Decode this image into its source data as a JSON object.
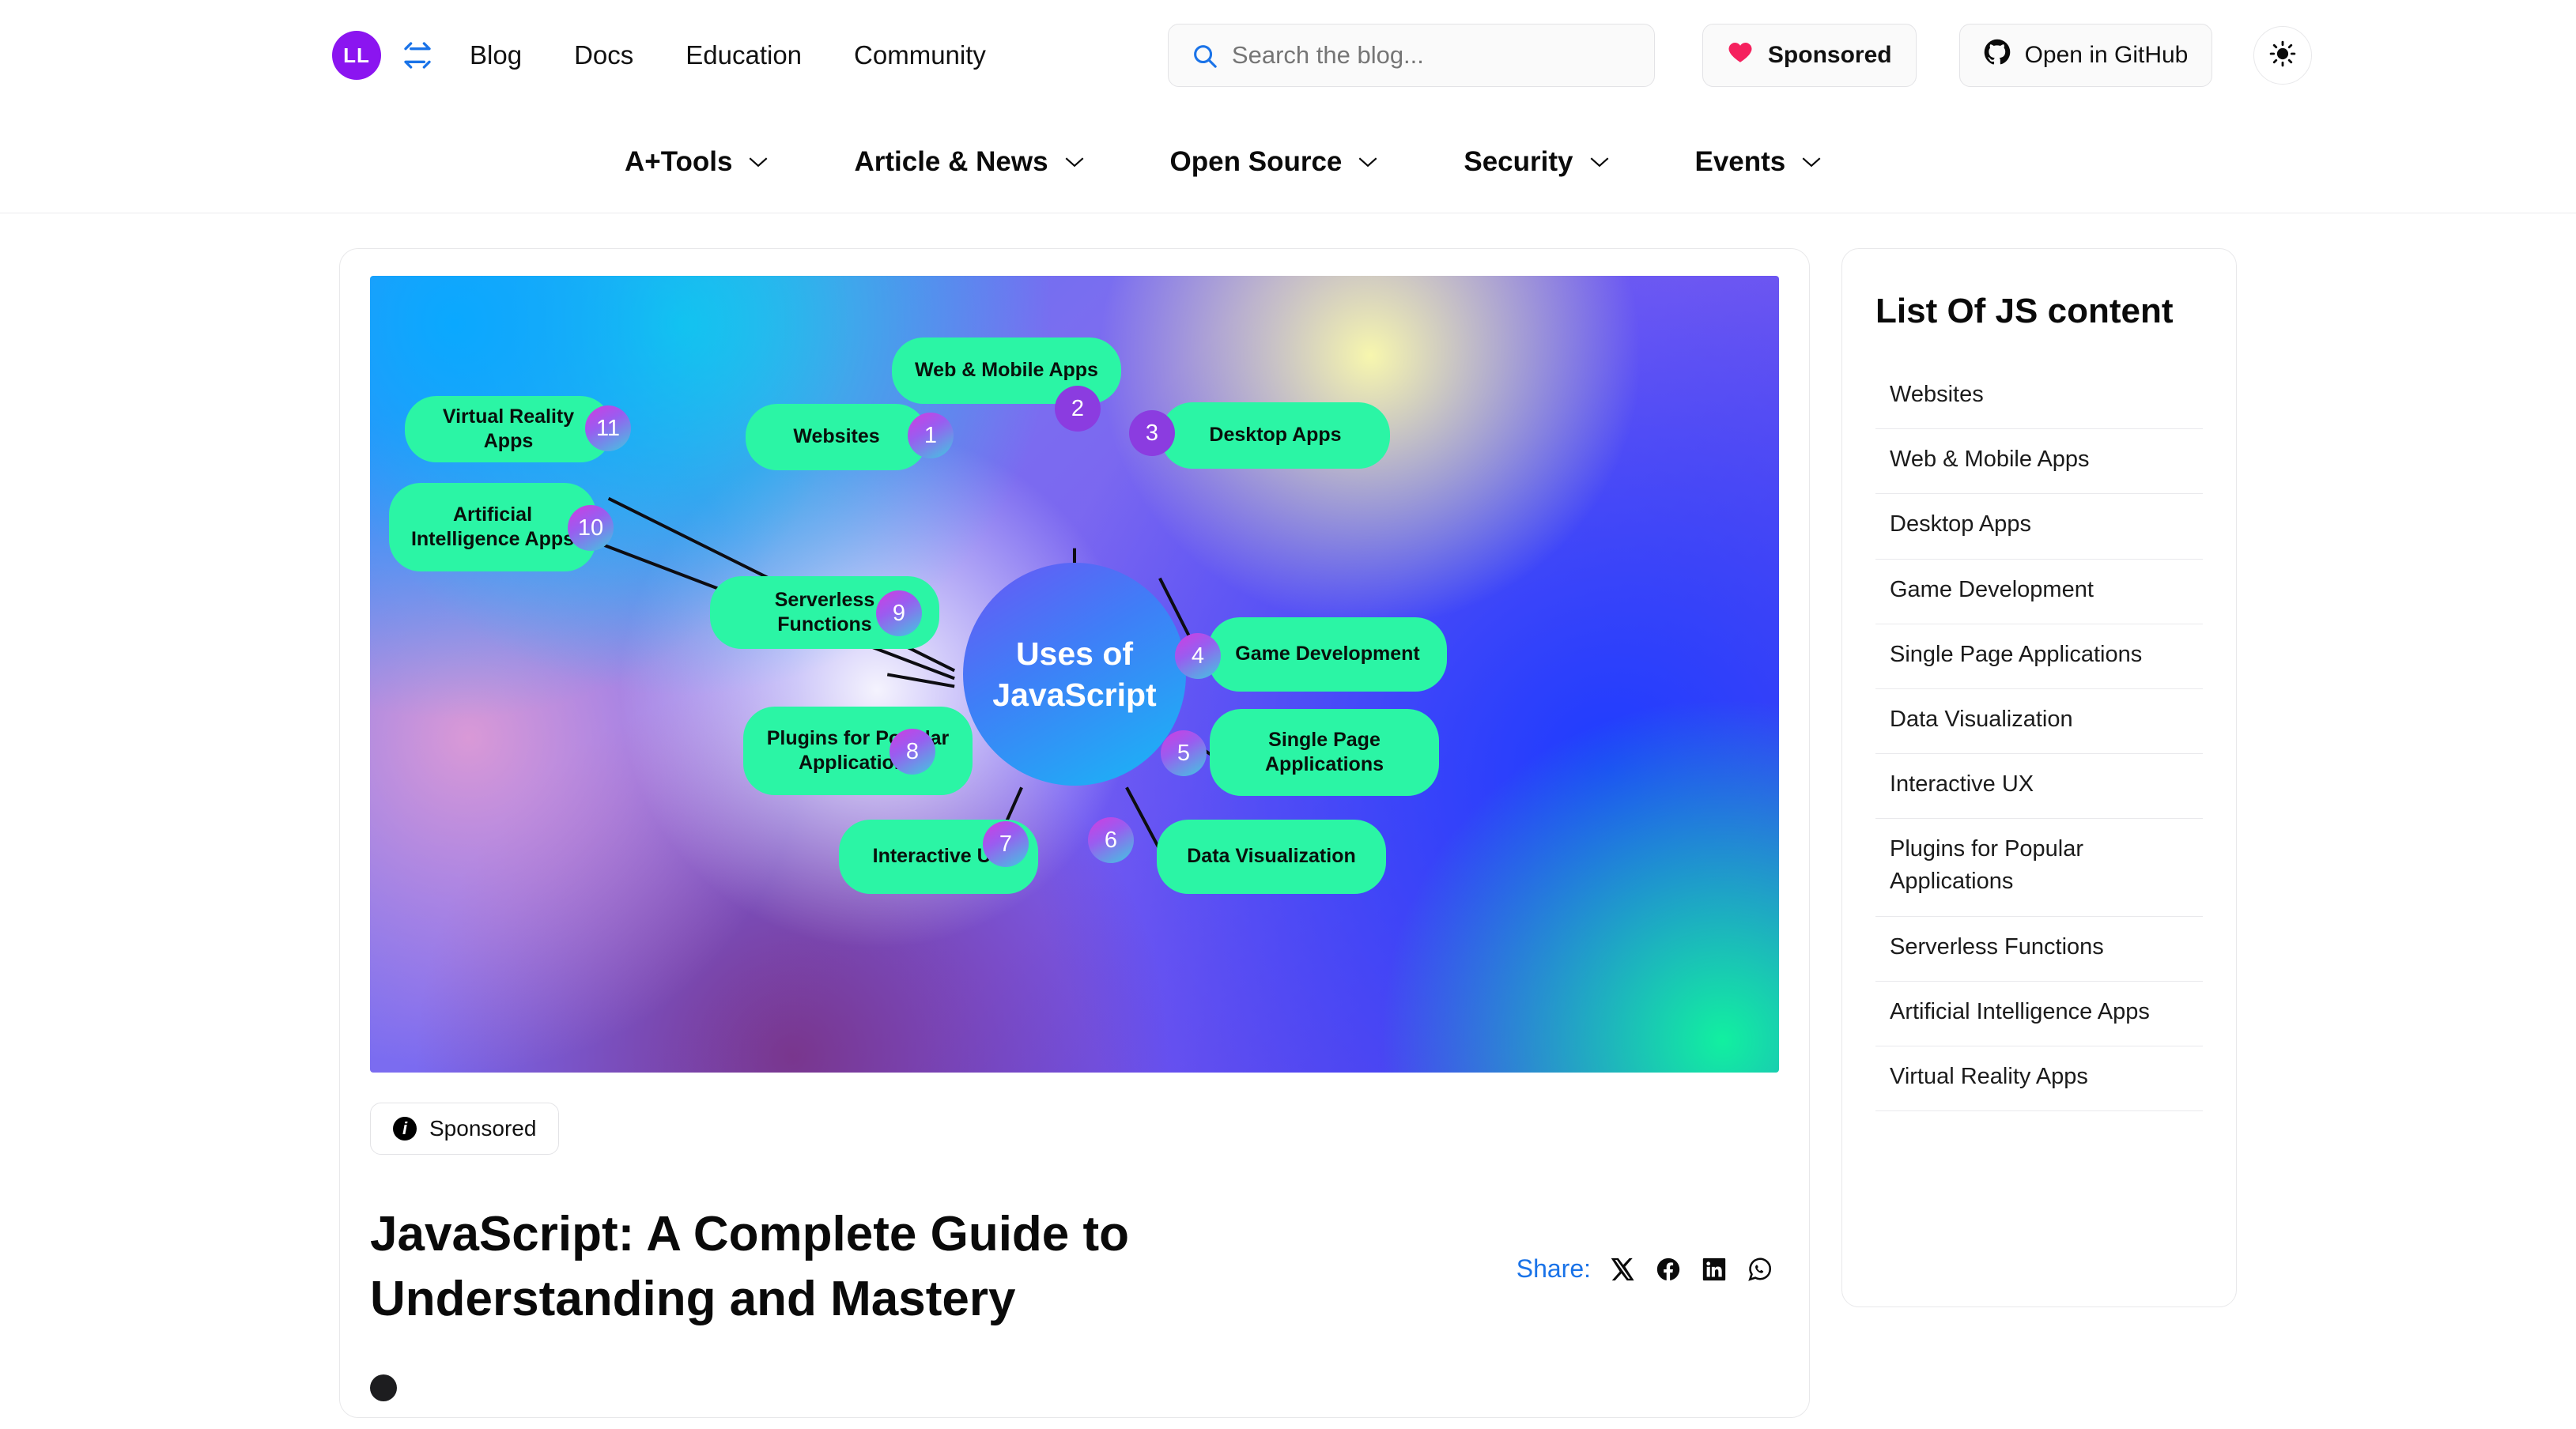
{
  "header": {
    "logo_text": "LL",
    "logo_icon": "swap-arrows-icon",
    "nav": [
      {
        "label": "Blog"
      },
      {
        "label": "Docs"
      },
      {
        "label": "Education"
      },
      {
        "label": "Community"
      }
    ],
    "search": {
      "placeholder": "Search the blog...",
      "value": "",
      "icon": "search-icon"
    },
    "sponsored_button": {
      "label": "Sponsored",
      "icon": "heart-icon",
      "color": "#f5215e"
    },
    "github_button": {
      "label": "Open in GitHub",
      "icon": "github-icon"
    },
    "theme_toggle": {
      "icon": "sun-icon",
      "label": ""
    }
  },
  "meganav": [
    {
      "label": "A+Tools",
      "icon": "chevron-down-icon"
    },
    {
      "label": "Article & News",
      "icon": "chevron-down-icon"
    },
    {
      "label": "Open Source",
      "icon": "chevron-down-icon"
    },
    {
      "label": "Security",
      "icon": "chevron-down-icon"
    },
    {
      "label": "Events",
      "icon": "chevron-down-icon"
    }
  ],
  "article": {
    "sponsored_tag": {
      "label": "Sponsored",
      "icon": "info-icon"
    },
    "title": "JavaScript: A Complete Guide to Understanding and Mastery",
    "share": {
      "label": "Share:",
      "targets": [
        {
          "name": "x-icon"
        },
        {
          "name": "facebook-icon"
        },
        {
          "name": "linkedin-icon"
        },
        {
          "name": "whatsapp-icon"
        }
      ]
    }
  },
  "mindmap": {
    "center": "Uses of JavaScript",
    "accent_pill": "#2bf5a5",
    "accent_center": "#3f7ef7",
    "nodes": [
      {
        "number": "1",
        "label": "Websites"
      },
      {
        "number": "2",
        "label": "Web & Mobile Apps"
      },
      {
        "number": "3",
        "label": "Desktop Apps"
      },
      {
        "number": "4",
        "label": "Game Development"
      },
      {
        "number": "5",
        "label": "Single Page Applications"
      },
      {
        "number": "6",
        "label": "Data Visualization"
      },
      {
        "number": "7",
        "label": "Interactive UX"
      },
      {
        "number": "8",
        "label": "Plugins for Popular Applications"
      },
      {
        "number": "9",
        "label": "Serverless Functions"
      },
      {
        "number": "10",
        "label": "Artificial Intelligence Apps"
      },
      {
        "number": "11",
        "label": "Virtual Reality Apps"
      }
    ]
  },
  "toc": {
    "title": "List Of JS content",
    "items": [
      {
        "label": "Websites"
      },
      {
        "label": "Web & Mobile Apps"
      },
      {
        "label": "Desktop Apps"
      },
      {
        "label": "Game Development"
      },
      {
        "label": "Single Page Applications"
      },
      {
        "label": "Data Visualization"
      },
      {
        "label": "Interactive UX"
      },
      {
        "label": "Plugins for Popular Applications"
      },
      {
        "label": "Serverless Functions"
      },
      {
        "label": "Artificial Intelligence Apps"
      },
      {
        "label": "Virtual Reality Apps"
      }
    ]
  }
}
